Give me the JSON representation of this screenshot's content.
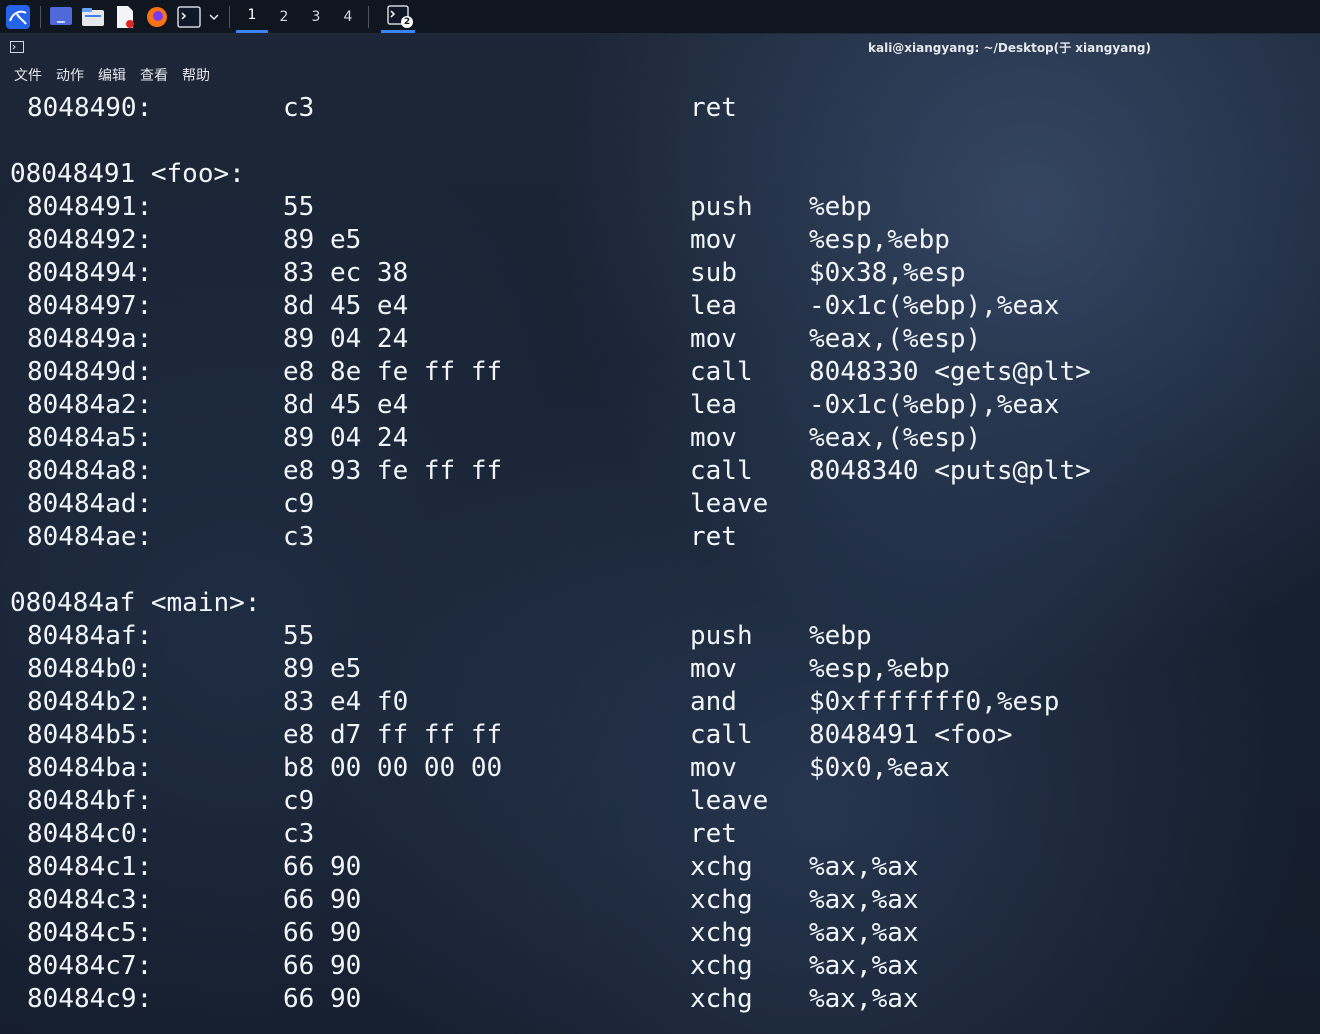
{
  "taskbar": {
    "workspaces": [
      "1",
      "2",
      "3",
      "4"
    ],
    "active_workspace": "1",
    "terminal_badge": "2"
  },
  "window": {
    "title": "kali@xiangyang: ~/Desktop(于 xiangyang)"
  },
  "menu": {
    "items": [
      "文件",
      "动作",
      "编辑",
      "查看",
      "帮助"
    ]
  },
  "terminal": {
    "lines": [
      {
        "type": "ins",
        "addr": "8048490:",
        "bytes": "c3",
        "mnem": "ret",
        "ops": ""
      },
      {
        "type": "blank"
      },
      {
        "type": "label",
        "text": "08048491 <foo>:"
      },
      {
        "type": "ins",
        "addr": "8048491:",
        "bytes": "55",
        "mnem": "push",
        "ops": "%ebp"
      },
      {
        "type": "ins",
        "addr": "8048492:",
        "bytes": "89 e5",
        "mnem": "mov",
        "ops": "%esp,%ebp"
      },
      {
        "type": "ins",
        "addr": "8048494:",
        "bytes": "83 ec 38",
        "mnem": "sub",
        "ops": "$0x38,%esp"
      },
      {
        "type": "ins",
        "addr": "8048497:",
        "bytes": "8d 45 e4",
        "mnem": "lea",
        "ops": "-0x1c(%ebp),%eax"
      },
      {
        "type": "ins",
        "addr": "804849a:",
        "bytes": "89 04 24",
        "mnem": "mov",
        "ops": "%eax,(%esp)"
      },
      {
        "type": "ins",
        "addr": "804849d:",
        "bytes": "e8 8e fe ff ff",
        "mnem": "call",
        "ops": "8048330 <gets@plt>"
      },
      {
        "type": "ins",
        "addr": "80484a2:",
        "bytes": "8d 45 e4",
        "mnem": "lea",
        "ops": "-0x1c(%ebp),%eax"
      },
      {
        "type": "ins",
        "addr": "80484a5:",
        "bytes": "89 04 24",
        "mnem": "mov",
        "ops": "%eax,(%esp)"
      },
      {
        "type": "ins",
        "addr": "80484a8:",
        "bytes": "e8 93 fe ff ff",
        "mnem": "call",
        "ops": "8048340 <puts@plt>"
      },
      {
        "type": "ins",
        "addr": "80484ad:",
        "bytes": "c9",
        "mnem": "leave",
        "ops": ""
      },
      {
        "type": "ins",
        "addr": "80484ae:",
        "bytes": "c3",
        "mnem": "ret",
        "ops": ""
      },
      {
        "type": "blank"
      },
      {
        "type": "label",
        "text": "080484af <main>:"
      },
      {
        "type": "ins",
        "addr": "80484af:",
        "bytes": "55",
        "mnem": "push",
        "ops": "%ebp"
      },
      {
        "type": "ins",
        "addr": "80484b0:",
        "bytes": "89 e5",
        "mnem": "mov",
        "ops": "%esp,%ebp"
      },
      {
        "type": "ins",
        "addr": "80484b2:",
        "bytes": "83 e4 f0",
        "mnem": "and",
        "ops": "$0xfffffff0,%esp"
      },
      {
        "type": "ins",
        "addr": "80484b5:",
        "bytes": "e8 d7 ff ff ff",
        "mnem": "call",
        "ops": "8048491 <foo>"
      },
      {
        "type": "ins",
        "addr": "80484ba:",
        "bytes": "b8 00 00 00 00",
        "mnem": "mov",
        "ops": "$0x0,%eax"
      },
      {
        "type": "ins",
        "addr": "80484bf:",
        "bytes": "c9",
        "mnem": "leave",
        "ops": ""
      },
      {
        "type": "ins",
        "addr": "80484c0:",
        "bytes": "c3",
        "mnem": "ret",
        "ops": ""
      },
      {
        "type": "ins",
        "addr": "80484c1:",
        "bytes": "66 90",
        "mnem": "xchg",
        "ops": "%ax,%ax"
      },
      {
        "type": "ins",
        "addr": "80484c3:",
        "bytes": "66 90",
        "mnem": "xchg",
        "ops": "%ax,%ax"
      },
      {
        "type": "ins",
        "addr": "80484c5:",
        "bytes": "66 90",
        "mnem": "xchg",
        "ops": "%ax,%ax"
      },
      {
        "type": "ins",
        "addr": "80484c7:",
        "bytes": "66 90",
        "mnem": "xchg",
        "ops": "%ax,%ax"
      },
      {
        "type": "ins",
        "addr": "80484c9:",
        "bytes": "66 90",
        "mnem": "xchg",
        "ops": "%ax,%ax"
      }
    ]
  }
}
